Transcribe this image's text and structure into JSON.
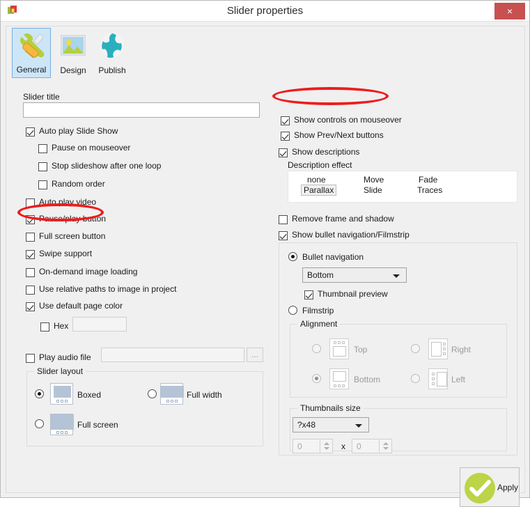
{
  "window": {
    "title": "Slider properties",
    "close_label": "×",
    "app_icon": "app-logo-icon"
  },
  "toolbar": {
    "tabs": [
      {
        "label": "General",
        "icon": "tools-icon",
        "selected": true
      },
      {
        "label": "Design",
        "icon": "image-icon",
        "selected": false
      },
      {
        "label": "Publish",
        "icon": "globe-icon",
        "selected": false
      }
    ]
  },
  "left_panel": {
    "slider_title_label": "Slider title",
    "slider_title_value": "",
    "options": [
      {
        "label": "Auto play Slide Show",
        "checked": true
      },
      {
        "label": "Pause on mouseover",
        "checked": false
      },
      {
        "label": "Stop slideshow after one loop",
        "checked": false
      },
      {
        "label": "Random order",
        "checked": false
      },
      {
        "label": "Auto play video",
        "checked": false
      },
      {
        "label": "Pause/play button",
        "checked": true
      },
      {
        "label": "Full screen button",
        "checked": false
      },
      {
        "label": "Swipe support",
        "checked": true
      },
      {
        "label": "On-demand image loading",
        "checked": false
      },
      {
        "label": "Use relative paths to image in project",
        "checked": false
      },
      {
        "label": "Use default page color",
        "checked": true
      },
      {
        "label": "Hex",
        "checked": false
      },
      {
        "label": "Play audio file",
        "checked": false
      }
    ],
    "hex_value": "",
    "audio_path_value": "",
    "browse_label": "...",
    "slider_layout": {
      "title": "Slider layout",
      "options": [
        {
          "label": "Boxed",
          "selected": true
        },
        {
          "label": "Full width",
          "selected": false
        },
        {
          "label": "Full screen",
          "selected": false
        }
      ]
    }
  },
  "right_panel": {
    "options": [
      {
        "label": "Show controls on mouseover",
        "checked": true
      },
      {
        "label": "Show Prev/Next buttons",
        "checked": true
      },
      {
        "label": "Show descriptions",
        "checked": true
      },
      {
        "label": "Remove frame and shadow",
        "checked": false
      },
      {
        "label": "Show bullet navigation/Filmstrip",
        "checked": true
      },
      {
        "label": "Thumbnail preview",
        "checked": true
      }
    ],
    "description_effect": {
      "label": "Description effect",
      "items": [
        {
          "label": "none",
          "selected": false
        },
        {
          "label": "Move",
          "selected": false
        },
        {
          "label": "Fade",
          "selected": false
        },
        {
          "label": "Parallax",
          "selected": true
        },
        {
          "label": "Slide",
          "selected": false
        },
        {
          "label": "Traces",
          "selected": false
        }
      ]
    },
    "navigation": {
      "bullet_label": "Bullet navigation",
      "bullet_selected": true,
      "position_value": "Bottom",
      "filmstrip_label": "Filmstrip",
      "filmstrip_selected": false
    },
    "alignment": {
      "title": "Alignment",
      "options": [
        {
          "label": "Top",
          "selected": false
        },
        {
          "label": "Right",
          "selected": false
        },
        {
          "label": "Bottom",
          "selected": true
        },
        {
          "label": "Left",
          "selected": false
        }
      ]
    },
    "thumbnails_size": {
      "title": "Thumbnails size",
      "preset_value": "?x48",
      "width_value": "0",
      "height_value": "0",
      "separator": "x"
    }
  },
  "footer": {
    "apply_label": "Apply",
    "apply_icon": "check-circle-icon"
  },
  "annotations": {
    "accent_color": "#ee1c1c",
    "highlighted": [
      "Show controls on mouseover",
      "Pause/play button"
    ]
  }
}
